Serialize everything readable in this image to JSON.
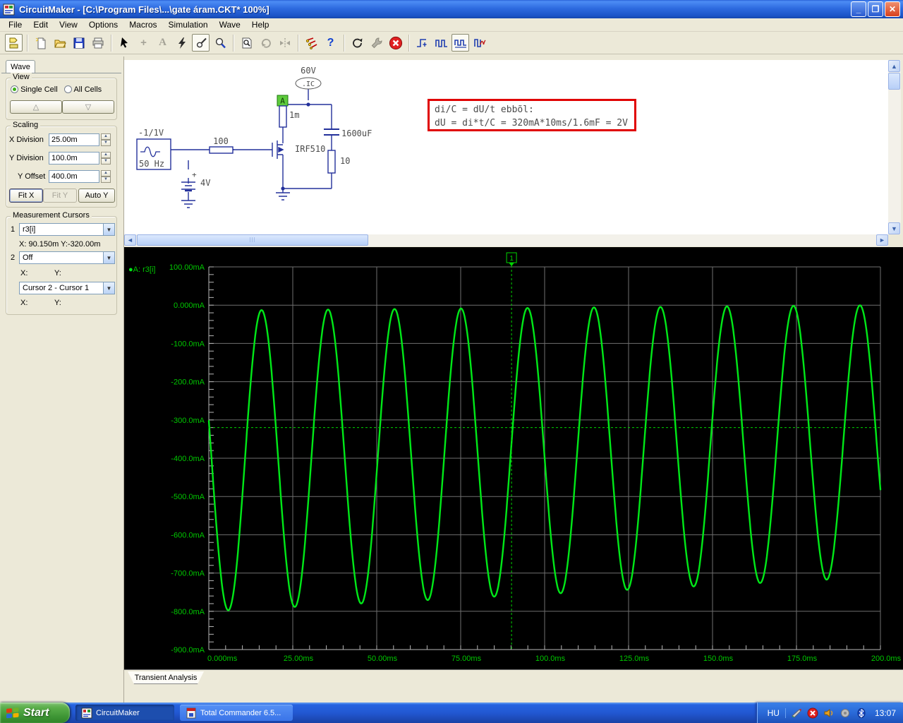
{
  "colors": {
    "trace": "#00e818",
    "plot_text": "#00c800",
    "grid": "#6f6f6f",
    "axis": "#b8b8b8",
    "cursor": "#00d400",
    "annotation_border": "#e00000",
    "wire": "#23309b",
    "schematic_text": "#4b4b4b",
    "probe_green": "#5ecb3c",
    "titlebar_blue": "#2e6be0",
    "taskbar_blue": "#2258d2",
    "start_green": "#3d9434"
  },
  "window": {
    "title": "CircuitMaker - [C:\\Program Files\\...\\gate áram.CKT* 100%]",
    "minimize": "_",
    "restore": "❐",
    "close": "✕"
  },
  "menu": {
    "items": [
      "File",
      "Edit",
      "View",
      "Options",
      "Macros",
      "Simulation",
      "Wave",
      "Help"
    ]
  },
  "toolbar": {
    "icons": [
      "parts-browser",
      "new-file",
      "open-file",
      "save-file",
      "print",
      "select-arrow",
      "add-plus",
      "text-tool",
      "run-bolt",
      "probe-tool",
      "zoom-tool",
      "find-device",
      "rotate",
      "mirror",
      "digital-switches",
      "help",
      "reset",
      "device-properties",
      "stop-simulation",
      "step-waveforms",
      "digital-waveforms",
      "analog-waveforms",
      "mixed-waveforms"
    ],
    "text_tool_glyph": "A",
    "plus_glyph": "+",
    "help_glyph": "?"
  },
  "side_panel": {
    "tab": "Wave",
    "view": {
      "label": "View",
      "single_cell": "Single Cell",
      "all_cells": "All Cells",
      "up_glyph": "△",
      "down_glyph": "▽"
    },
    "scaling": {
      "label": "Scaling",
      "x_division_label": "X Division",
      "x_division": "25.00m",
      "y_division_label": "Y Division",
      "y_division": "100.0m",
      "y_offset_label": "Y Offset",
      "y_offset": "400.0m",
      "fit_x": "Fit X",
      "fit_y": "Fit Y",
      "auto_y": "Auto Y"
    },
    "cursors": {
      "label": "Measurement Cursors",
      "c1_index": "1",
      "c1_value": "r3[i]",
      "c1_xy": "X: 90.150m  Y:-320.00m",
      "c2_index": "2",
      "c2_value": "Off",
      "x_label": "X:",
      "y_label": "Y:",
      "diff_value": "Cursor 2 - Cursor 1"
    }
  },
  "schematic": {
    "annotation_line1": "di/C = dU/t ebbõl:",
    "annotation_line2": "dU = di*t/C = 320mA*10ms/1.6mF = 2V",
    "labels": {
      "supply": "60V",
      "ic": ".IC",
      "probe": "A",
      "r_drain": "1m",
      "mosfet": "IRF510",
      "cap": "1600uF",
      "r_load": "10",
      "r_gate": "100",
      "src_amp": "-1/1V",
      "src_freq": "50 Hz",
      "bias": "4V"
    }
  },
  "chart_data": {
    "type": "line",
    "title": "Transient Analysis",
    "trace_label": "A: r3[i]",
    "trace_bullet": "●",
    "x_unit": "ms",
    "y_unit": "mA",
    "xlim_ms": [
      0,
      200
    ],
    "ylim_mA": [
      -900,
      100
    ],
    "x_ticks": [
      "0.000ms",
      "25.00ms",
      "50.00ms",
      "75.00ms",
      "100.0ms",
      "125.0ms",
      "150.0ms",
      "175.0ms",
      "200.0ms"
    ],
    "x_tick_values_ms": [
      0,
      25,
      50,
      75,
      100,
      125,
      150,
      175,
      200
    ],
    "y_ticks": [
      "100.00mA",
      "0.000mA",
      "-100.0mA",
      "-200.0mA",
      "-300.0mA",
      "-400.0mA",
      "-500.0mA",
      "-600.0mA",
      "-700.0mA",
      "-800.0mA",
      "-900.0mA"
    ],
    "y_tick_values_mA": [
      100,
      0,
      -100,
      -200,
      -300,
      -400,
      -500,
      -600,
      -700,
      -800,
      -900
    ],
    "x_minor_step_ms": 5,
    "y_minor_step_mA": 20,
    "grid": true,
    "legend_position": "top-left",
    "signal": {
      "shape": "sine",
      "period_ms": 19.8,
      "phase_rad": 2.872,
      "center_mA_start": -407,
      "center_mA_end": -355,
      "amplitude_mA_start": 393,
      "amplitude_mA_end": 355,
      "start_value_mA": -320
    },
    "peaks_mA": [
      -14,
      -11,
      -9,
      -7,
      -5,
      -4,
      -3,
      -2,
      -1,
      -2
    ],
    "troughs_mA": [
      -800,
      -795,
      -780,
      -770,
      -755,
      -745,
      -735,
      -725,
      -715,
      -710
    ],
    "cursor1": {
      "x_ms": 90.15,
      "y_mA": -320,
      "flag_label": "1"
    }
  },
  "wave_tab": "Transient Analysis",
  "taskbar": {
    "start": "Start",
    "tasks": [
      {
        "label": "CircuitMaker"
      },
      {
        "label": "Total Commander 6.5..."
      }
    ],
    "tray": {
      "lang": "HU",
      "time": "13:07"
    }
  }
}
